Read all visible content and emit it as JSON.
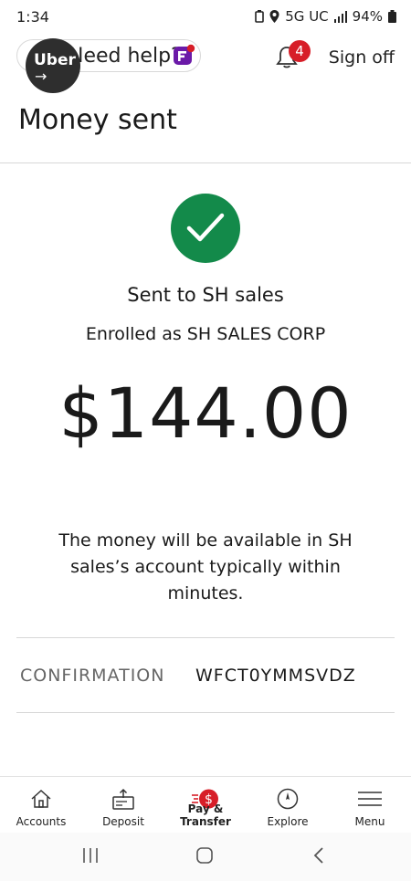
{
  "status_bar": {
    "time": "1:34",
    "network": "5G UC",
    "battery": "94%"
  },
  "header": {
    "help_label": "Need help?",
    "notifications_count": "4",
    "sign_off_label": "Sign off"
  },
  "uber_bubble": {
    "label": "Uber",
    "arrow": "→"
  },
  "page": {
    "title": "Money sent",
    "sent_to": "Sent to SH sales",
    "enrolled_as": "Enrolled as SH SALES CORP",
    "amount": "$144.00",
    "availability": "The money will be available in SH sales’s account typically within minutes.",
    "confirmation_label": "CONFIRMATION",
    "confirmation_value": "WFCT0YMMSVDZ"
  },
  "bottom_nav": {
    "items": [
      {
        "label": "Accounts",
        "icon": "home-icon"
      },
      {
        "label": "Deposit",
        "icon": "deposit-icon"
      },
      {
        "label": "Pay & Transfer",
        "icon": "pay-transfer-icon",
        "active": true
      },
      {
        "label": "Explore",
        "icon": "compass-icon"
      },
      {
        "label": "Menu",
        "icon": "hamburger-icon"
      }
    ]
  },
  "colors": {
    "success": "#138a4a",
    "brand_red": "#d71e28",
    "badge": "#d71e28"
  }
}
